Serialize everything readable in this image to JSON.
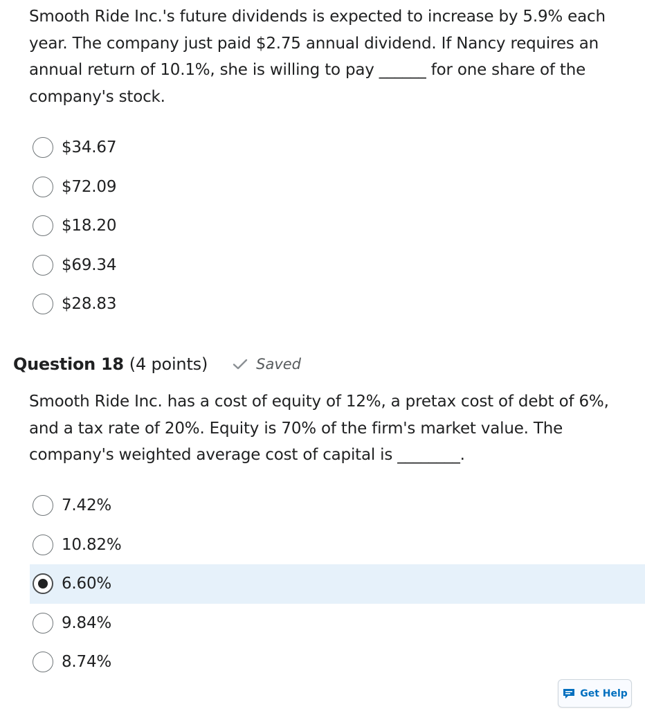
{
  "question_17": {
    "text": "Smooth Ride Inc.'s future dividends is expected to increase by 5.9% each year.  The company just paid $2.75 annual dividend. If Nancy requires an annual return of 10.1%, she is willing to pay ______ for one share of the company's stock.",
    "options": [
      "$34.67",
      "$72.09",
      "$18.20",
      "$69.34",
      "$28.83"
    ]
  },
  "question_18": {
    "title": "Question 18",
    "points": "(4 points)",
    "status": "Saved",
    "text": "Smooth Ride Inc. has a cost of equity of 12%, a pretax cost of debt of 6%, and a tax rate of 20%. Equity is 70% of the firm's market value. The company's weighted average cost of capital is ________.",
    "options": [
      "7.42%",
      "10.82%",
      "6.60%",
      "9.84%",
      "8.74%"
    ],
    "selected": "6.60%"
  },
  "help_button": {
    "label": "Get Help",
    "icon": "chat-bubble-icon"
  },
  "colors": {
    "accent": "#006fbf",
    "selected_row": "#e6f1fa",
    "text": "#202122"
  }
}
